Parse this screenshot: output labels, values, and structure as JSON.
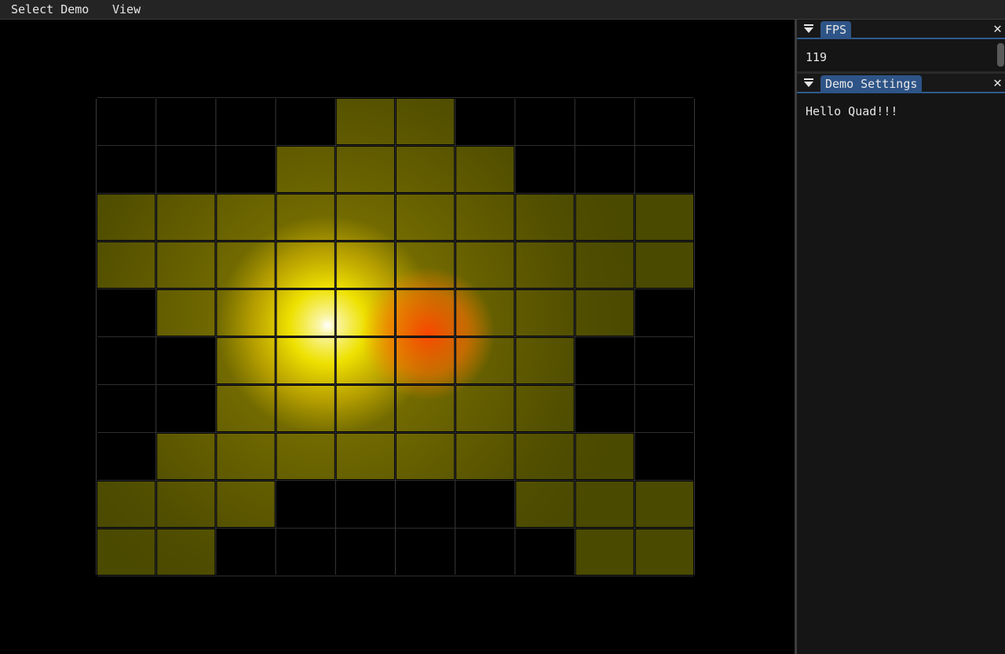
{
  "menubar": {
    "select_demo": "Select Demo",
    "view": "View"
  },
  "fps_window": {
    "title": "FPS",
    "value": "119",
    "close_glyph": "✕"
  },
  "settings_window": {
    "title": "Demo Settings",
    "text": "Hello Quad!!!",
    "close_glyph": "✕"
  },
  "scene": {
    "background": "#000000",
    "grid": {
      "columns": 10,
      "rows": 10,
      "filled_pattern": [
        "0000110000",
        "0001111000",
        "1111111111",
        "1111111111",
        "0111111110",
        "0011111100",
        "0011111100",
        "0111111110",
        "1110000111",
        "1100000011"
      ]
    },
    "tile_base_color": "#4a4a00",
    "light_colors": [
      "#ffffff",
      "#fff100",
      "#ff5a00"
    ]
  }
}
